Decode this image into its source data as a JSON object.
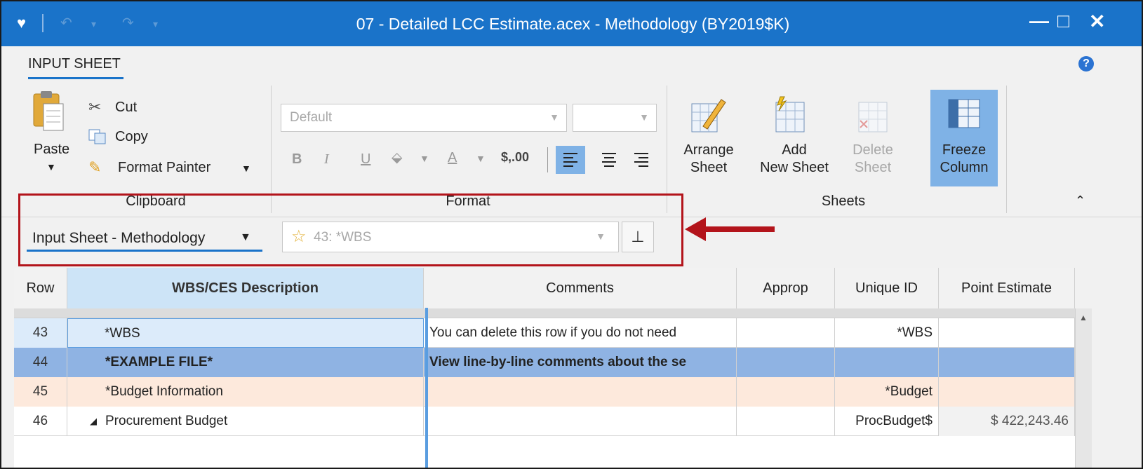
{
  "window": {
    "title": "07 - Detailed LCC Estimate.acex - Methodology (BY2019$K)",
    "minimize": "—",
    "maximize": "□",
    "close": "✕"
  },
  "ribbon": {
    "tab": "INPUT SHEET",
    "groups": {
      "clipboard": "Clipboard",
      "format": "Format",
      "sheets": "Sheets"
    },
    "clipboard": {
      "paste": "Paste",
      "cut": "Cut",
      "copy": "Copy",
      "format_painter": "Format Painter"
    },
    "format": {
      "font_placeholder": "Default",
      "bold": "B",
      "italic": "I",
      "underline": "U",
      "currency": "$,.00"
    },
    "sheets": {
      "arrange_line1": "Arrange",
      "arrange_line2": "Sheet",
      "add_line1": "Add",
      "add_line2": "New Sheet",
      "delete_line1": "Delete",
      "delete_line2": "Sheet",
      "freeze_line1": "Freeze",
      "freeze_line2": "Column"
    }
  },
  "toolbar": {
    "sheet_selector": "Input Sheet - Methodology",
    "wbs_selector": "43: *WBS"
  },
  "grid": {
    "columns": [
      "Row",
      "WBS/CES Description",
      "Comments",
      "Approp",
      "Unique ID",
      "Point Estimate"
    ],
    "rows": [
      {
        "row": "43",
        "description": "*WBS",
        "comments": "You can delete this row if you do not need",
        "approp": "",
        "unique_id": "*WBS",
        "point_estimate": ""
      },
      {
        "row": "44",
        "description": "*EXAMPLE FILE*",
        "comments": "View line-by-line comments about the se",
        "approp": "",
        "unique_id": "",
        "point_estimate": ""
      },
      {
        "row": "45",
        "description": "*Budget Information",
        "comments": "",
        "approp": "",
        "unique_id": "*Budget",
        "point_estimate": ""
      },
      {
        "row": "46",
        "description": "Procurement Budget",
        "comments": "",
        "approp": "",
        "unique_id": "ProcBudget$",
        "point_estimate": "$ 422,243.46"
      }
    ]
  },
  "colors": {
    "titlebar": "#1a73c9",
    "accent": "#1a73c9",
    "annotation_red": "#b3141b",
    "selected_row": "#8fb3e3",
    "budget_row": "#fde9dc",
    "row43_highlight": "#dcebfa"
  }
}
